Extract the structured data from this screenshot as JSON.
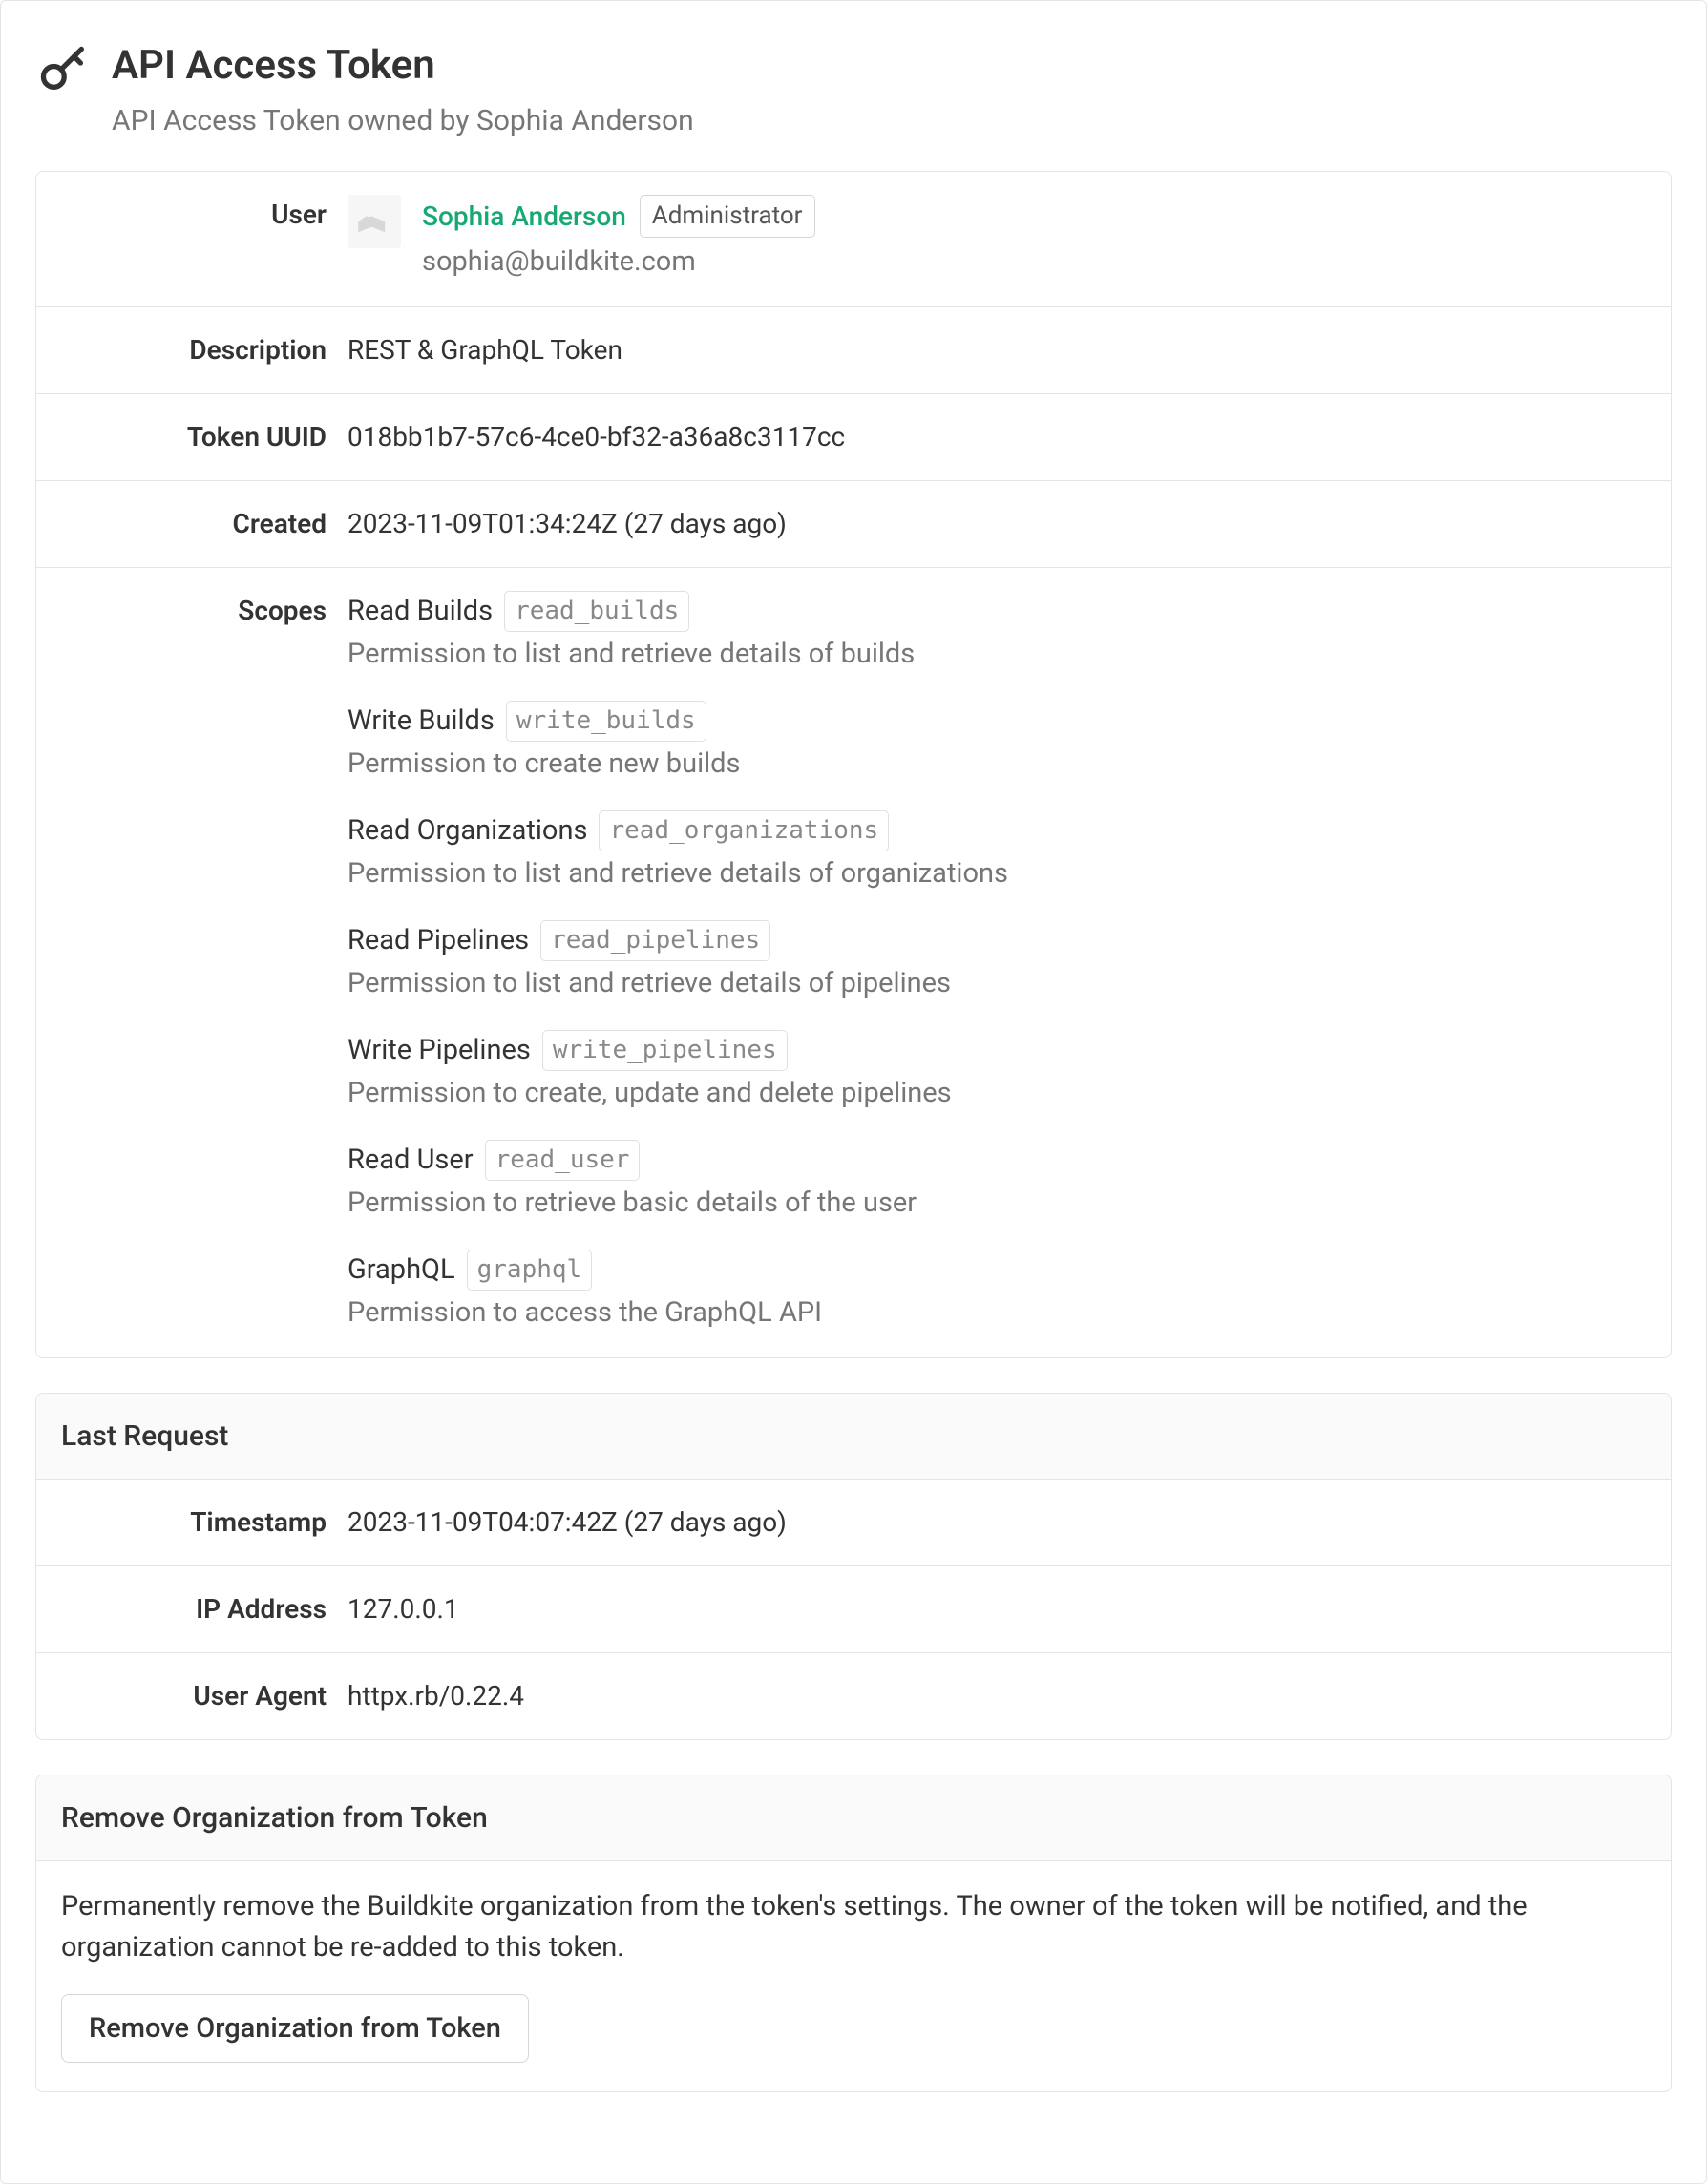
{
  "header": {
    "title": "API Access Token",
    "subtitle": "API Access Token owned by Sophia Anderson"
  },
  "details": {
    "user_label": "User",
    "user_name": "Sophia Anderson",
    "user_role": "Administrator",
    "user_email": "sophia@buildkite.com",
    "description_label": "Description",
    "description_value": "REST & GraphQL Token",
    "uuid_label": "Token UUID",
    "uuid_value": "018bb1b7-57c6-4ce0-bf32-a36a8c3117cc",
    "created_label": "Created",
    "created_value": "2023-11-09T01:34:24Z (27 days ago)",
    "scopes_label": "Scopes",
    "scopes": [
      {
        "title": "Read Builds",
        "code": "read_builds",
        "desc": "Permission to list and retrieve details of builds"
      },
      {
        "title": "Write Builds",
        "code": "write_builds",
        "desc": "Permission to create new builds"
      },
      {
        "title": "Read Organizations",
        "code": "read_organizations",
        "desc": "Permission to list and retrieve details of organizations"
      },
      {
        "title": "Read Pipelines",
        "code": "read_pipelines",
        "desc": "Permission to list and retrieve details of pipelines"
      },
      {
        "title": "Write Pipelines",
        "code": "write_pipelines",
        "desc": "Permission to create, update and delete pipelines"
      },
      {
        "title": "Read User",
        "code": "read_user",
        "desc": "Permission to retrieve basic details of the user"
      },
      {
        "title": "GraphQL",
        "code": "graphql",
        "desc": "Permission to access the GraphQL API"
      }
    ]
  },
  "last_request": {
    "heading": "Last Request",
    "timestamp_label": "Timestamp",
    "timestamp_value": "2023-11-09T04:07:42Z (27 days ago)",
    "ip_label": "IP Address",
    "ip_value": "127.0.0.1",
    "ua_label": "User Agent",
    "ua_value": "httpx.rb/0.22.4"
  },
  "remove": {
    "heading": "Remove Organization from Token",
    "body": "Permanently remove the Buildkite organization from the token's settings. The owner of the token will be notified, and the organization cannot be re-added to this token.",
    "button": "Remove Organization from Token"
  }
}
